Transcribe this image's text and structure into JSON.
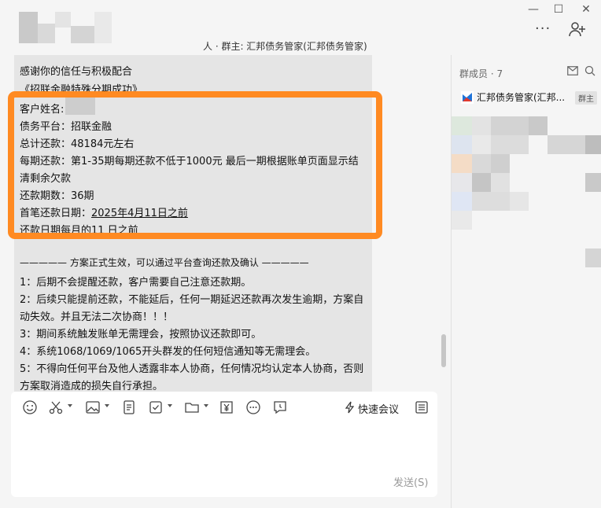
{
  "header": {
    "title": "人 · 群主: 汇邦债务管家(汇邦债务管家)",
    "more_label": "···"
  },
  "window_controls": {
    "minimize": "—",
    "maximize": "☐",
    "close": "✕"
  },
  "chat": {
    "lines": [
      "感谢你的信任与积极配合",
      "《招联金融特殊分期成功》",
      "客户姓名:",
      "债务平台：招联金融",
      "总计还款：48184元左右",
      "每期还款：第1-35期每期还款不低于1000元  最后一期根据账单页面显示结",
      "清剩余欠款",
      "还款期数：36期",
      "首笔还款日期：",
      "还款日期每月的11 日之前",
      "————— 方案正式生效，可以通过平台查询还款及确认 —————",
      "1：后期不会提醒还款，客户需要自己注意还款期。",
      "2：后续只能提前还款，不能延后，任何一期延迟还款再次发生逾期，方案自",
      "动失效。并且无法二次协商！！！",
      "3：期间系统触发账单无需理会，按照协议还款即可。",
      "4：系统1068/1069/1065开头群发的任何短信通知等无需理会。",
      "5：不得向任何平台及他人透露非本人协商，任何情况均认定本人协商，否则",
      "方案取消造成的损失自行承担。"
    ],
    "first_payment_date": "2025年4月11日之前"
  },
  "sidebar": {
    "title": "群成员 · 7",
    "members": [
      {
        "name": "汇邦债务管家(汇邦...",
        "badge": "群主"
      }
    ]
  },
  "input_bar": {
    "quick_meeting_label": "快速会议",
    "send_label": "发送(S)"
  },
  "colors": {
    "highlight": "#ff8a22",
    "bubble": "#e5e5e5",
    "background": "#f5f5f5"
  }
}
